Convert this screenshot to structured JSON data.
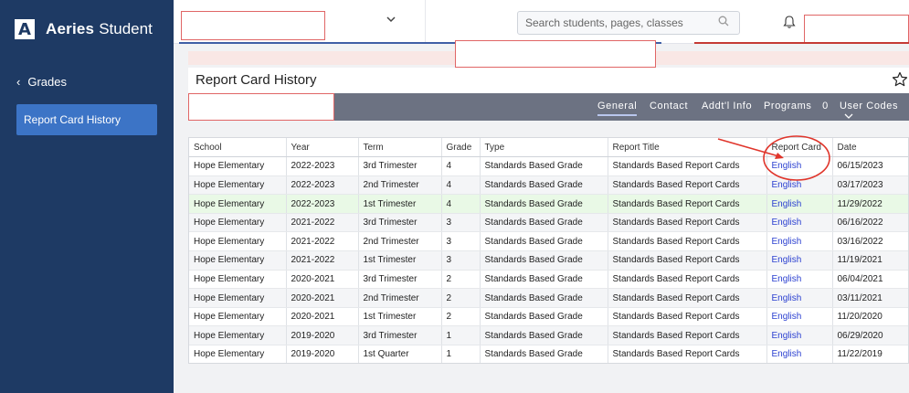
{
  "brand": {
    "name": "Aeries",
    "product": "Student",
    "logo_letter": "A"
  },
  "sidebar": {
    "back_label": "Grades",
    "items": [
      {
        "label": "Report Card History"
      }
    ]
  },
  "topbar": {
    "search_placeholder": "Search students, pages, classes"
  },
  "page": {
    "title": "Report Card History"
  },
  "tabs": [
    {
      "label": "General"
    },
    {
      "label": "Contact"
    },
    {
      "label": "Addt'l Info"
    },
    {
      "label": "Programs",
      "count": "0"
    },
    {
      "label": "User Codes"
    }
  ],
  "table": {
    "headers": [
      "School",
      "Year",
      "Term",
      "Grade",
      "Type",
      "Report Title",
      "Report Card",
      "Date"
    ],
    "rows": [
      [
        "Hope Elementary",
        "2022-2023",
        "3rd Trimester",
        "4",
        "Standards Based Grade",
        "Standards Based Report Cards",
        "English",
        "06/15/2023"
      ],
      [
        "Hope Elementary",
        "2022-2023",
        "2nd Trimester",
        "4",
        "Standards Based Grade",
        "Standards Based Report Cards",
        "English",
        "03/17/2023"
      ],
      [
        "Hope Elementary",
        "2022-2023",
        "1st Trimester",
        "4",
        "Standards Based Grade",
        "Standards Based Report Cards",
        "English",
        "11/29/2022"
      ],
      [
        "Hope Elementary",
        "2021-2022",
        "3rd Trimester",
        "3",
        "Standards Based Grade",
        "Standards Based Report Cards",
        "English",
        "06/16/2022"
      ],
      [
        "Hope Elementary",
        "2021-2022",
        "2nd Trimester",
        "3",
        "Standards Based Grade",
        "Standards Based Report Cards",
        "English",
        "03/16/2022"
      ],
      [
        "Hope Elementary",
        "2021-2022",
        "1st Trimester",
        "3",
        "Standards Based Grade",
        "Standards Based Report Cards",
        "English",
        "11/19/2021"
      ],
      [
        "Hope Elementary",
        "2020-2021",
        "3rd Trimester",
        "2",
        "Standards Based Grade",
        "Standards Based Report Cards",
        "English",
        "06/04/2021"
      ],
      [
        "Hope Elementary",
        "2020-2021",
        "2nd Trimester",
        "2",
        "Standards Based Grade",
        "Standards Based Report Cards",
        "English",
        "03/11/2021"
      ],
      [
        "Hope Elementary",
        "2020-2021",
        "1st Trimester",
        "2",
        "Standards Based Grade",
        "Standards Based Report Cards",
        "English",
        "11/20/2020"
      ],
      [
        "Hope Elementary",
        "2019-2020",
        "3rd Trimester",
        "1",
        "Standards Based Grade",
        "Standards Based Report Cards",
        "English",
        "06/29/2020"
      ],
      [
        "Hope Elementary",
        "2019-2020",
        "1st Quarter",
        "1",
        "Standards Based Grade",
        "Standards Based Report Cards",
        "English",
        "11/22/2019"
      ]
    ],
    "highlighted_row": 2
  },
  "colors": {
    "sidebar": "#1e3a64",
    "sidebar_active": "#3c74c6",
    "tabbar": "#6c7282",
    "link": "#2a3fd0",
    "annotation": "#e0352b",
    "highlight_row": "#e9f9e6"
  },
  "icons": [
    "back-chevron-icon",
    "dropdown-chevron-icon",
    "search-icon",
    "bell-icon",
    "star-icon",
    "user-codes-chevron-icon"
  ]
}
